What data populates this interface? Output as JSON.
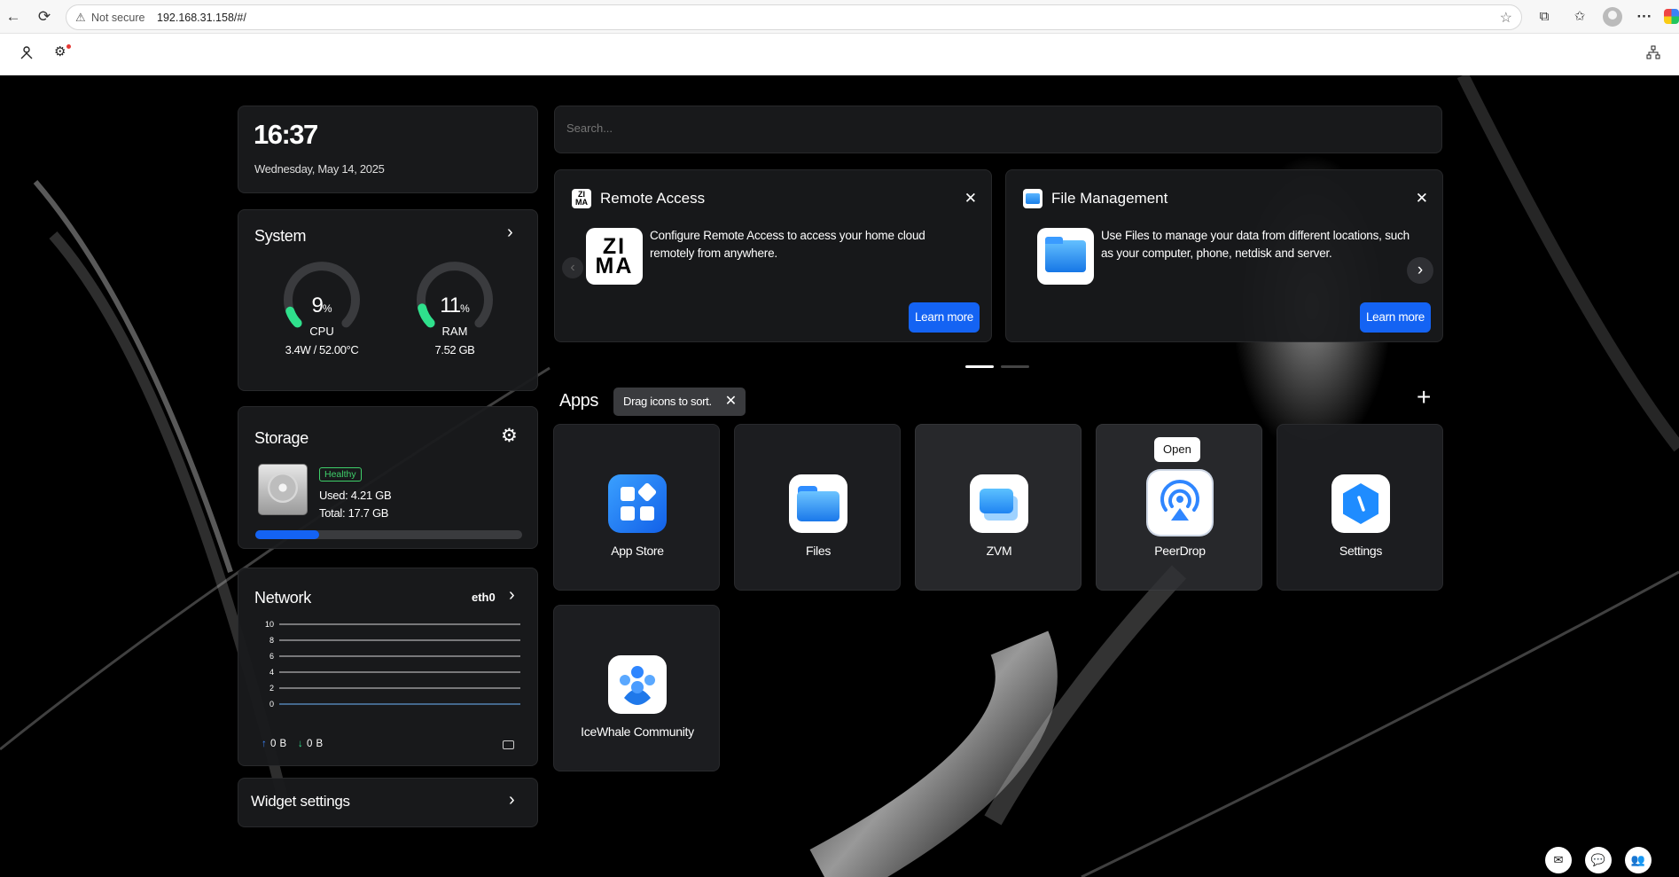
{
  "browser": {
    "security_label": "Not secure",
    "url": "192.168.31.158/#/"
  },
  "clock": {
    "time": "16:37",
    "date": "Wednesday, May 14, 2025"
  },
  "system": {
    "title": "System",
    "cpu": {
      "value": "9",
      "unit": "%",
      "label": "CPU",
      "sub": "3.4W / 52.00°C",
      "percent": 9
    },
    "ram": {
      "value": "11",
      "unit": "%",
      "label": "RAM",
      "sub": "7.52 GB",
      "percent": 11
    }
  },
  "storage": {
    "title": "Storage",
    "badge": "Healthy",
    "used": "Used: 4.21 GB",
    "total": "Total: 17.7 GB",
    "fill_fraction": 0.24
  },
  "network": {
    "title": "Network",
    "interface": "eth0",
    "y_ticks": [
      "10",
      "8",
      "6",
      "4",
      "2",
      "0"
    ],
    "upload": "0 B",
    "download": "0 B"
  },
  "widget_settings": {
    "label": "Widget settings"
  },
  "search": {
    "placeholder": "Search..."
  },
  "promos": [
    {
      "title": "Remote Access",
      "logo_text": "ZI\nMA",
      "text": "Configure Remote Access to access your home cloud remotely from anywhere.",
      "button": "Learn more"
    },
    {
      "title": "File Management",
      "text": "Use Files to manage your data from different locations, such as your computer, phone, netdisk and server.",
      "button": "Learn more"
    }
  ],
  "apps_section": {
    "title": "Apps",
    "hint": "Drag icons to sort.",
    "items": [
      {
        "label": "App Store"
      },
      {
        "label": "Files"
      },
      {
        "label": "ZVM"
      },
      {
        "label": "PeerDrop"
      },
      {
        "label": "Settings"
      },
      {
        "label": "IceWhale Community"
      }
    ],
    "tooltip": "Open"
  },
  "colors": {
    "accent": "#1463f3",
    "gauge_green": "#2fe08c",
    "healthy_green": "#3fcf6a",
    "card_bg": "#1a1b1d"
  }
}
